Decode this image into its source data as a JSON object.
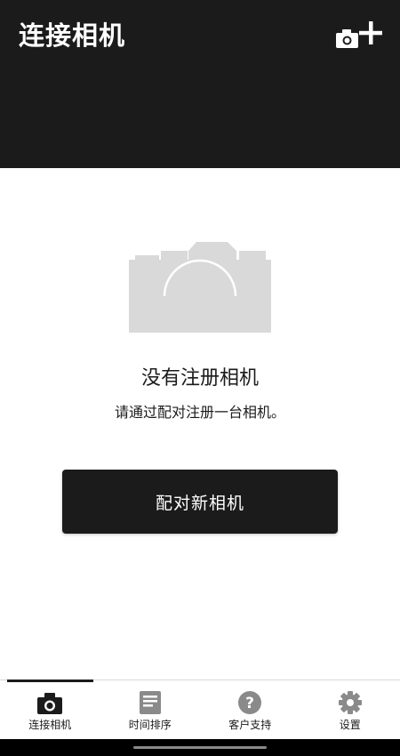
{
  "header": {
    "title": "连接相机",
    "add_camera_icon": "camera-add-icon"
  },
  "empty_state": {
    "illustration_icon": "camera-placeholder-icon",
    "title": "没有注册相机",
    "subtitle": "请通过配对注册一台相机。"
  },
  "actions": {
    "pair_label": "配对新相机"
  },
  "bottom_nav": {
    "items": [
      {
        "label": "连接相机",
        "icon": "camera-icon",
        "active": true
      },
      {
        "label": "时间排序",
        "icon": "list-icon",
        "active": false
      },
      {
        "label": "客户支持",
        "icon": "help-icon",
        "active": false
      },
      {
        "label": "设置",
        "icon": "gear-icon",
        "active": false
      }
    ]
  },
  "colors": {
    "header_bg": "#1b1b1b",
    "button_bg": "#1b1b1b",
    "placeholder_gray": "#d9d9d9",
    "inactive_icon": "#8a8a8a"
  }
}
